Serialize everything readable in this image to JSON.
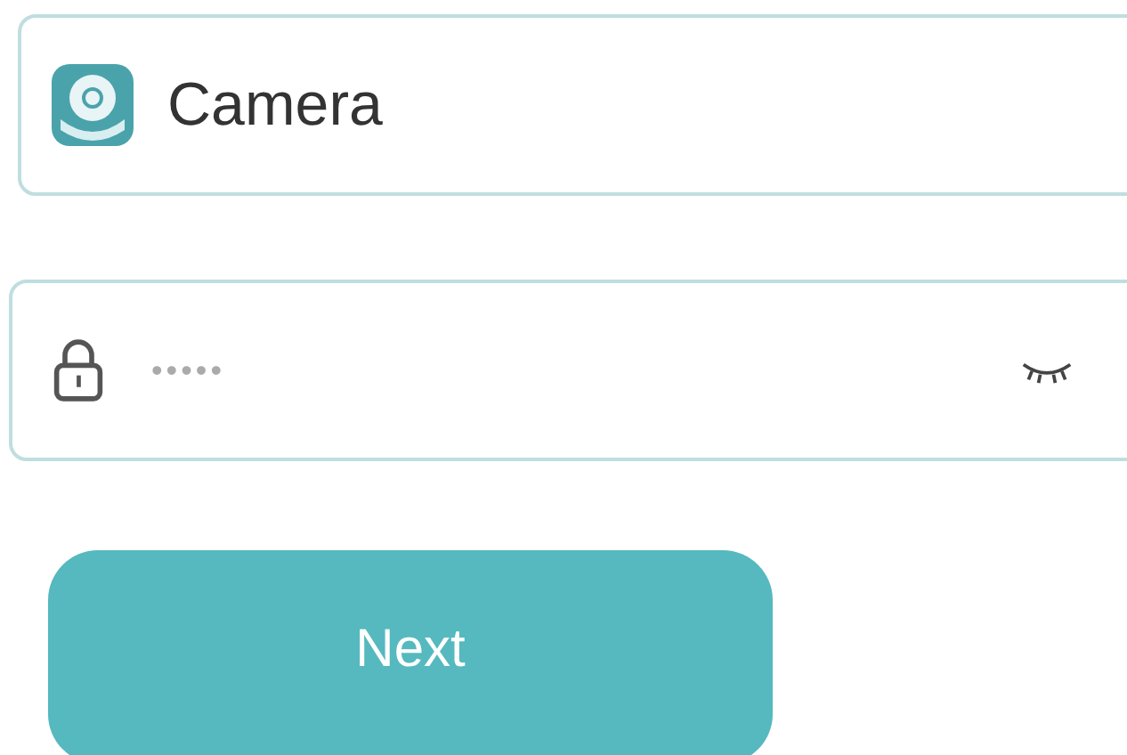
{
  "device_field": {
    "value": "Camera"
  },
  "password_field": {
    "placeholder": "•••••"
  },
  "next_button": {
    "label": "Next"
  }
}
